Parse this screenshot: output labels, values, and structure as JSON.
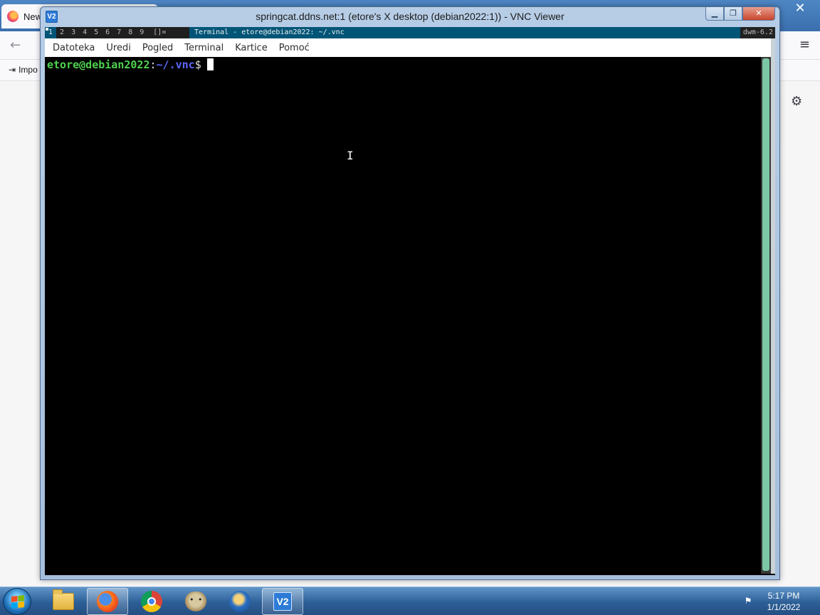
{
  "firefox": {
    "tab_title": "New",
    "close_glyph": "✕",
    "back_glyph": "←",
    "menu_glyph": "≡",
    "bookmark_import": "Impo",
    "gear_glyph": "⚙",
    "icons": [
      "firefox-icon",
      "back-arrow-icon",
      "hamburger-menu-icon",
      "import-icon",
      "gear-icon"
    ]
  },
  "vnc": {
    "title": "springcat.ddns.net:1 (etore's X desktop (debian2022:1)) - VNC Viewer",
    "app_icon": "V2",
    "buttons": {
      "minimize": "▁",
      "maximize": "❐",
      "close": "✕"
    }
  },
  "dwm": {
    "tags": [
      "1",
      "2",
      "3",
      "4",
      "5",
      "6",
      "7",
      "8",
      "9"
    ],
    "active_tag": "1",
    "layout": "[]=",
    "window_title": "Terminal - etore@debian2022: ~/.vnc",
    "status": "dwm-6.2",
    "colors": {
      "bar": "#1f1f1f",
      "selected": "#005577"
    }
  },
  "terminal": {
    "menu": [
      "Datoteka",
      "Uredi",
      "Pogled",
      "Terminal",
      "Kartice",
      "Pomoć"
    ],
    "prompt": {
      "user_host": "etore@debian2022",
      "colon": ":",
      "path": "~/.vnc",
      "symbol": "$"
    },
    "colors": {
      "user": "#4fd14f",
      "path": "#5c67ff",
      "background": "#000000"
    },
    "ibeam_glyph": "I"
  },
  "taskbar": {
    "items": [
      {
        "name": "windows-explorer-icon"
      },
      {
        "name": "firefox-icon"
      },
      {
        "name": "chrome-icon"
      },
      {
        "name": "gimp-icon"
      },
      {
        "name": "thunderbird-icon"
      },
      {
        "name": "vnc-viewer-icon",
        "label": "V2",
        "active": true
      }
    ],
    "tray_icon_glyph": "⚑",
    "time": "5:17 PM",
    "date": "1/1/2022"
  }
}
